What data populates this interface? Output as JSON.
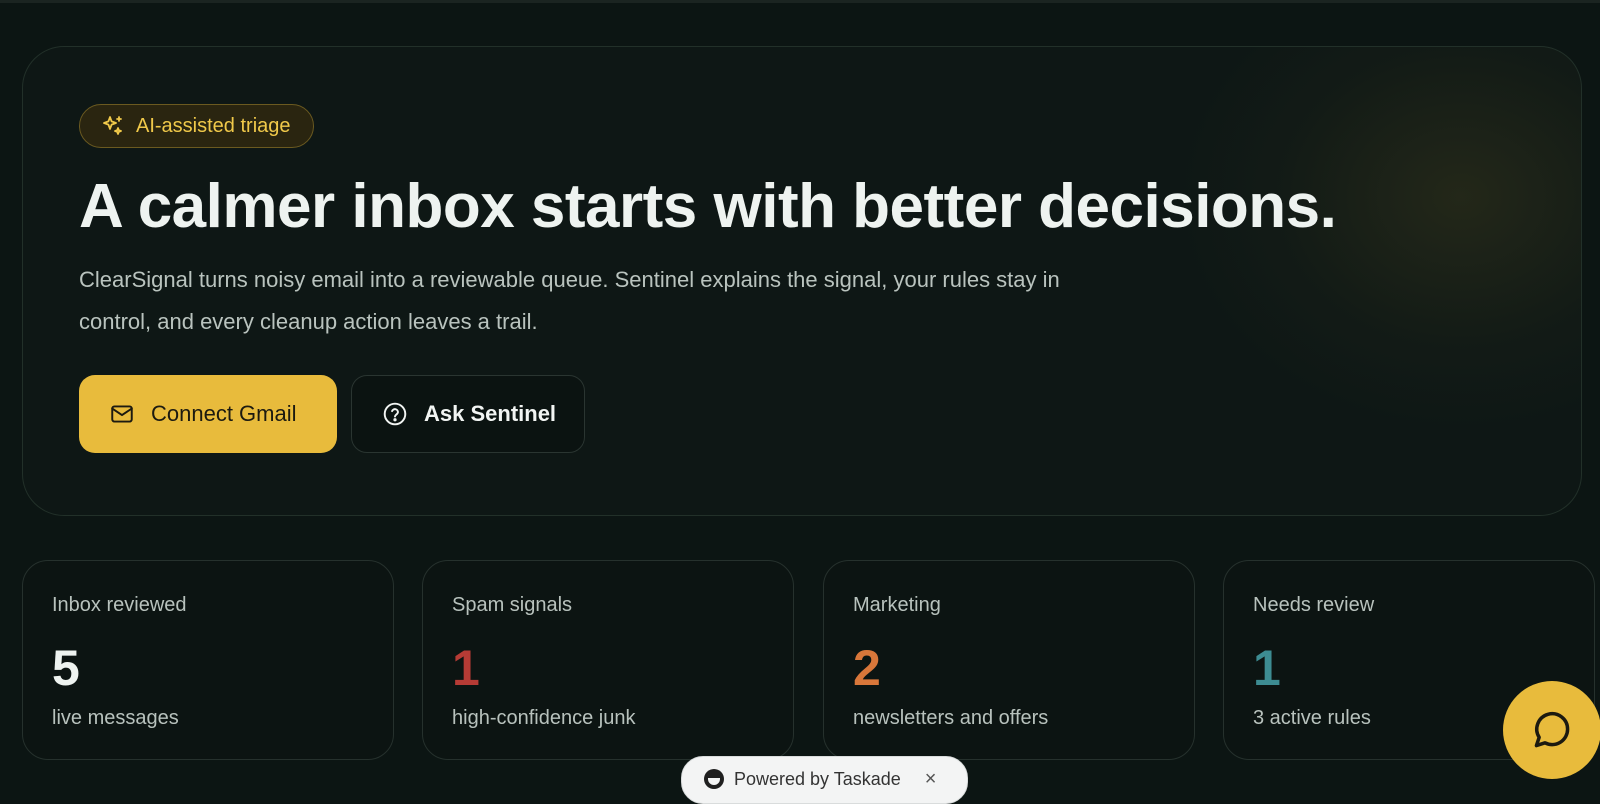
{
  "hero": {
    "badge_label": "AI-assisted triage",
    "title": "A calmer inbox starts with better decisions.",
    "description": "ClearSignal turns noisy email into a reviewable queue. Sentinel explains the signal, your rules stay in control, and every cleanup action leaves a trail.",
    "primary_button": "Connect Gmail",
    "secondary_button": "Ask Sentinel"
  },
  "stats": [
    {
      "label": "Inbox reviewed",
      "value": "5",
      "sub": "live messages",
      "color": "#eef3f0"
    },
    {
      "label": "Spam signals",
      "value": "1",
      "sub": "high-confidence junk",
      "color": "#b63b35"
    },
    {
      "label": "Marketing",
      "value": "2",
      "sub": "newsletters and offers",
      "color": "#d9773a"
    },
    {
      "label": "Needs review",
      "value": "1",
      "sub": "3 active rules",
      "color": "#3d8c92"
    }
  ],
  "footer": {
    "powered_by": "Powered by Taskade",
    "close_symbol": "×"
  },
  "colors": {
    "accent": "#e8bb3c",
    "background": "#0c1513"
  },
  "icons": {
    "badge": "sparkles-icon",
    "primary_button": "mail-icon",
    "secondary_button": "help-circle-icon",
    "chat": "chat-bubble-icon"
  }
}
